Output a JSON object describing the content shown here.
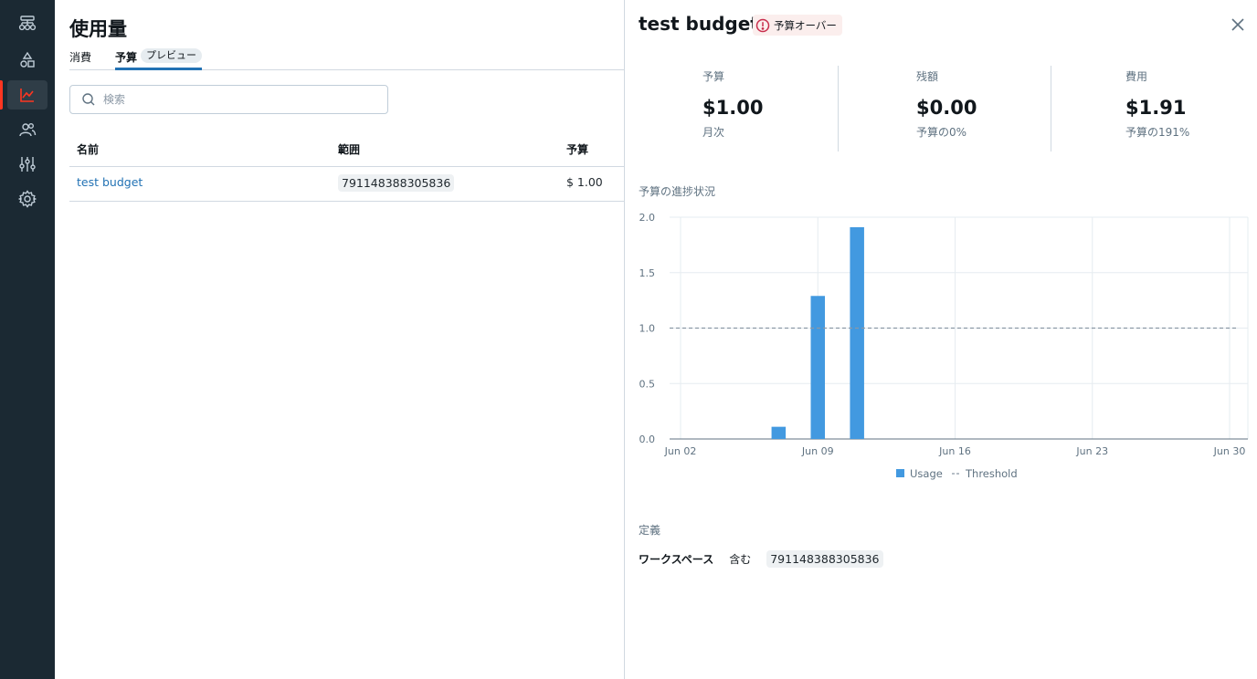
{
  "sidebar": {
    "items": [
      {
        "icon": "workflows-icon"
      },
      {
        "icon": "catalog-icon"
      },
      {
        "icon": "usage-chart-icon",
        "active": true
      },
      {
        "icon": "users-icon"
      },
      {
        "icon": "sliders-icon"
      },
      {
        "icon": "gear-icon"
      }
    ]
  },
  "main": {
    "title": "使用量",
    "tabs": {
      "consume": "消費",
      "budget": "予算",
      "preview": "プレビュー"
    },
    "search": {
      "placeholder": "検索"
    },
    "table": {
      "headers": {
        "name": "名前",
        "scope": "範囲",
        "budget": "予算"
      },
      "rows": [
        {
          "name": "test budget",
          "scope": "791148388305836",
          "budget": "$ 1.00"
        }
      ]
    }
  },
  "detail": {
    "title": "test budget",
    "status_badge": "予算オーバー",
    "stats": [
      {
        "label": "予算",
        "value": "$1.00",
        "sub": "月次"
      },
      {
        "label": "残額",
        "value": "$0.00",
        "sub": "予算の0%"
      },
      {
        "label": "費用",
        "value": "$1.91",
        "sub": "予算の191%"
      }
    ],
    "progress_label": "予算の進捗状況",
    "definition_label": "定義",
    "definition": {
      "key": "ワークスペース",
      "operator": "含む",
      "value": "791148388305836"
    }
  },
  "colors": {
    "accent": "#2272b4",
    "bar": "#4299e0",
    "threshold": "#8b98a5",
    "over_badge_icon": "#c82d4c",
    "rail": "#1b2933",
    "active_marker": "#ff3621"
  },
  "chart_data": {
    "type": "bar",
    "ylim": [
      0,
      2.0
    ],
    "yticks": [
      "0.0",
      "0.5",
      "1.0",
      "1.5",
      "2.0"
    ],
    "xticks": [
      {
        "day": 2,
        "label": "Jun 02"
      },
      {
        "day": 9,
        "label": "Jun 09"
      },
      {
        "day": 16,
        "label": "Jun 16"
      },
      {
        "day": 23,
        "label": "Jun 23"
      },
      {
        "day": 30,
        "label": "Jun 30"
      }
    ],
    "series": [
      {
        "name": "Usage",
        "points": [
          {
            "day": 7,
            "value": 0.11
          },
          {
            "day": 9,
            "value": 1.29
          },
          {
            "day": 11,
            "value": 1.91
          }
        ]
      }
    ],
    "threshold": {
      "name": "Threshold",
      "value": 1.0
    },
    "legend": "bottom-center"
  }
}
